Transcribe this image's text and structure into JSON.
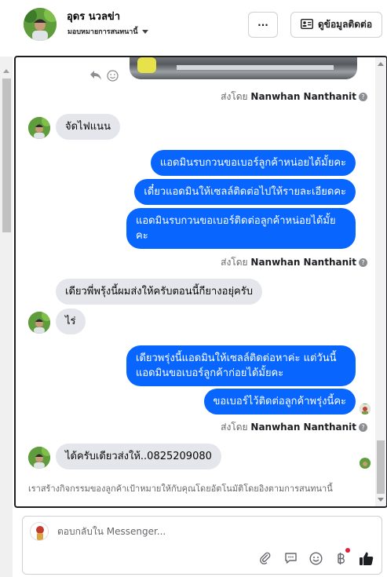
{
  "header": {
    "contact_name": "อุดร นวลข่า",
    "assignment": "มอบหมายการสนทนานี้",
    "more_label": "···",
    "info_button_label": "ดูข้อมูลติดต่อ"
  },
  "messages": [
    {
      "sentby_prefix": "ส่งโดย",
      "sentby_name": "Nanwhan Nanthanit"
    },
    {
      "text": "จัดไฟแนน"
    },
    {
      "text": "แอดมินรบกวนขอเบอร์ลูกค้าหน่อยได้มั้ยคะ"
    },
    {
      "text": "เดี๋ยวแอดมินให้เซลล์ติดต่อไปให้รายละเอียดคะ"
    },
    {
      "text": "แอดมินรบกวนขอเบอร์ติดต่อลูกค้าหน่อยได้มั้ยคะ"
    },
    {
      "sentby_prefix": "ส่งโดย",
      "sentby_name": "Nanwhan Nanthanit"
    },
    {
      "text": "เดียวพี่พรุ้งนี้ผมส่งให้ครับตอนนี้กียางอยุ่ครับ"
    },
    {
      "text": "ไร่"
    },
    {
      "text": "เดียวพรุ่งนี้แอดมินให้เซลล์ติดต่อหาค่ะ แต่วันนี้แอดมินขอเบอร์ลูกค้าก่อยได้มั้ยคะ"
    },
    {
      "text": "ขอเบอร์ไว้ติดต่อลูกค้าพรุ่งนี้คะ"
    },
    {
      "sentby_prefix": "ส่งโดย",
      "sentby_name": "Nanwhan Nanthanit"
    },
    {
      "text": "ได้ครับเดียวส่งให้..0825209080"
    }
  ],
  "activity_note": "เราสร้างกิจกรรมของลูกค้าเป้าหมายให้กับคุณโดยอัตโนมัติโดยอิงตามการสนทนานี้",
  "composer": {
    "placeholder": "ตอบกลับใน Messenger..."
  },
  "icons": {
    "more": "more-icon",
    "contact": "contact-card-icon",
    "reply": "reply-icon",
    "emoji": "emoji-icon",
    "attach": "paperclip-icon",
    "saved": "saved-reply-icon",
    "baht": "baht-icon",
    "like": "thumbs-up-icon"
  },
  "colors": {
    "outgoing_bubble": "#0866ff",
    "incoming_bubble": "#e4e6eb",
    "like_icon": "#1c1e21"
  }
}
